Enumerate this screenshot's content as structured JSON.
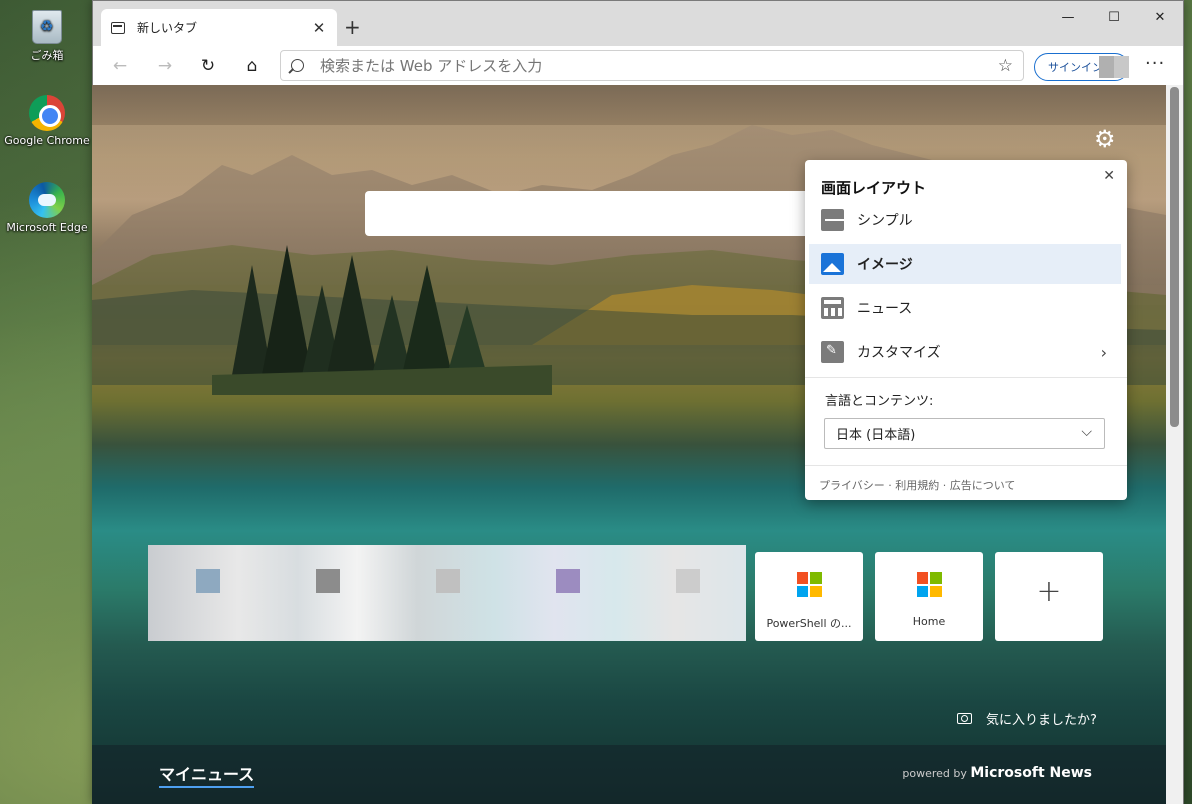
{
  "desktop": {
    "icons": [
      {
        "label": "ごみ箱"
      },
      {
        "label": "Google Chrome"
      },
      {
        "label": "Microsoft Edge"
      }
    ]
  },
  "browser": {
    "tab": {
      "title": "新しいタブ",
      "close": "✕"
    },
    "new_tab": "+",
    "window_controls": {
      "minimize": "—",
      "maximize": "☐",
      "close": "✕"
    },
    "nav": {
      "back": "←",
      "forward": "→",
      "refresh": "↻",
      "home": "⌂"
    },
    "address": {
      "placeholder": "検索または Web アドレスを入力",
      "value": ""
    },
    "favorite": "☆",
    "signin_label": "サインイン",
    "more": "···"
  },
  "ntp": {
    "settings_icon": "⚙",
    "layout_panel": {
      "title": "画面レイアウト",
      "close": "✕",
      "options": [
        {
          "label": "シンプル",
          "icon": "simple-layout-icon",
          "selected": false
        },
        {
          "label": "イメージ",
          "icon": "image-layout-icon",
          "selected": true
        },
        {
          "label": "ニュース",
          "icon": "news-layout-icon",
          "selected": false
        },
        {
          "label": "カスタマイズ",
          "icon": "customize-icon",
          "selected": false,
          "chevron": "›"
        }
      ],
      "language_label": "言語とコンテンツ:",
      "language_value": "日本 (日本語)",
      "language_arrow": "⌵",
      "footer": "プライバシー · 利用規約 · 広告について"
    },
    "tiles": [
      {
        "label": "PowerShell の..."
      },
      {
        "label": "Home"
      },
      {
        "label": "+"
      }
    ],
    "feedback": "気に入りましたか?",
    "newsbar": {
      "tab": "マイニュース",
      "powered_by": "powered by",
      "brand": "Microsoft News"
    }
  },
  "colors": {
    "accent": "#1a73d8",
    "ms_logo": [
      "#f25022",
      "#7fba00",
      "#00a4ef",
      "#ffb900"
    ]
  }
}
